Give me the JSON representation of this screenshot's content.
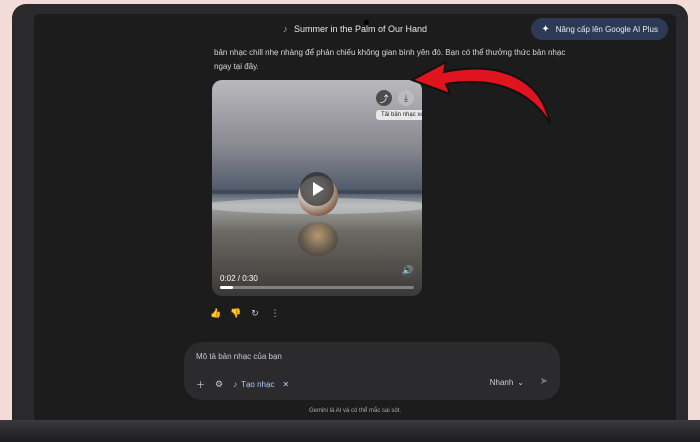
{
  "header": {
    "title": "Summer in the Palm of Our Hand",
    "upgrade_label": "Nâng cấp lên Google AI Plus"
  },
  "message": {
    "text": "bản nhạc chill nhẹ nhàng để phản chiếu không gian bình yên đó. Bạn có thể thưởng thức bản nhạc ngay tại đây."
  },
  "video": {
    "download_tooltip": "Tải bản nhạc xuống",
    "time": "0:02 / 0:30",
    "progress": 0.067
  },
  "prompt": {
    "placeholder": "Mô tả bản nhạc của bạn",
    "chip_label": "Tạo nhạc",
    "mode_label": "Nhanh"
  },
  "footer": {
    "disclaimer": "Gemini là AI và có thể mắc sai sót."
  },
  "colors": {
    "arrow": "#e0141e",
    "accent": "#aac8ff"
  }
}
